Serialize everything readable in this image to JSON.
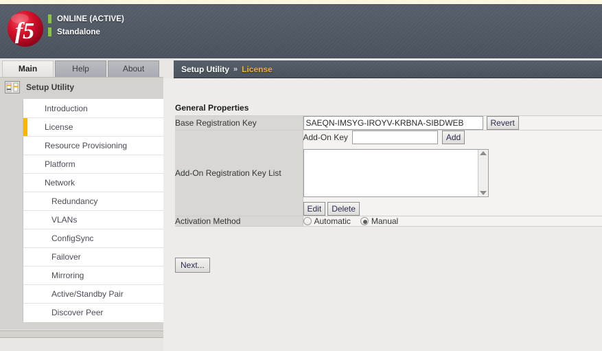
{
  "brand": {
    "logo_text": "f5",
    "logo_color": "#cf0a2c"
  },
  "header": {
    "status_primary": "ONLINE (ACTIVE)",
    "status_secondary": "Standalone",
    "status_indicator_color": "#8bc53f"
  },
  "tabs": [
    {
      "label": "Main",
      "active": true
    },
    {
      "label": "Help",
      "active": false
    },
    {
      "label": "About",
      "active": false
    }
  ],
  "sidebar": {
    "icon": "sliders-icon",
    "title": "Setup Utility",
    "active_marker_color": "#f7b600",
    "items": [
      {
        "label": "Introduction",
        "sub": false,
        "active": false
      },
      {
        "label": "License",
        "sub": false,
        "active": true
      },
      {
        "label": "Resource Provisioning",
        "sub": false,
        "active": false
      },
      {
        "label": "Platform",
        "sub": false,
        "active": false
      },
      {
        "label": "Network",
        "sub": false,
        "active": false
      },
      {
        "label": "Redundancy",
        "sub": true,
        "active": false
      },
      {
        "label": "VLANs",
        "sub": true,
        "active": false
      },
      {
        "label": "ConfigSync",
        "sub": true,
        "active": false
      },
      {
        "label": "Failover",
        "sub": true,
        "active": false
      },
      {
        "label": "Mirroring",
        "sub": true,
        "active": false
      },
      {
        "label": "Active/Standby Pair",
        "sub": true,
        "active": false
      },
      {
        "label": "Discover Peer",
        "sub": true,
        "active": false
      }
    ]
  },
  "breadcrumb": {
    "root": "Setup Utility",
    "separator": "»",
    "leaf": "License",
    "leaf_color": "#f0b323"
  },
  "main": {
    "section_title": "General Properties",
    "rows": {
      "base_registration_key": {
        "label": "Base Registration Key",
        "value": "SAEQN-IMSYG-IROYV-KRBNA-SIBDWEB",
        "placeholder": "",
        "revert_label": "Revert"
      },
      "addon_registration_key_list": {
        "label": "Add-On Registration Key List",
        "addon_key_label": "Add-On Key",
        "addon_key_value": "",
        "addon_key_placeholder": "",
        "add_label": "Add",
        "list_items": [],
        "edit_label": "Edit",
        "delete_label": "Delete"
      },
      "activation_method": {
        "label": "Activation Method",
        "options": [
          {
            "label": "Automatic",
            "selected": false
          },
          {
            "label": "Manual",
            "selected": true
          }
        ]
      }
    },
    "next_label": "Next..."
  }
}
